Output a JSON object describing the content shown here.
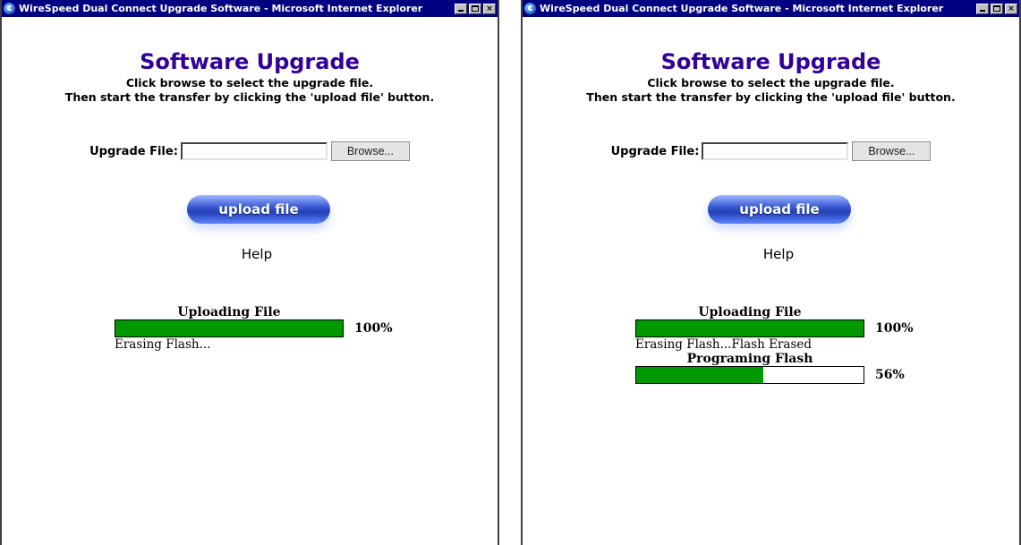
{
  "left_window": {
    "title": "WireSpeed Dual Connect Upgrade Software - Microsoft Internet Explorer",
    "heading": "Software Upgrade",
    "instruction_line1": "Click browse to select the upgrade file.",
    "instruction_line2": "Then start the transfer by clicking the 'upload file' button.",
    "file_label": "Upgrade File:",
    "file_value": "",
    "browse_label": "Browse...",
    "upload_label": "upload file",
    "help_label": "Help",
    "upload_progress": {
      "title": "Uploading File",
      "percent_label": "100%",
      "fraction": 1.0
    },
    "status_text": "Erasing Flash..."
  },
  "right_window": {
    "title": "WireSpeed Dual Connect Upgrade Software - Microsoft Internet Explorer",
    "heading": "Software Upgrade",
    "instruction_line1": "Click browse to select the upgrade file.",
    "instruction_line2": "Then start the transfer by clicking the 'upload file' button.",
    "file_label": "Upgrade File:",
    "file_value": "",
    "browse_label": "Browse...",
    "upload_label": "upload file",
    "help_label": "Help",
    "upload_progress": {
      "title": "Uploading File",
      "percent_label": "100%",
      "fraction": 1.0
    },
    "status_text": "Erasing Flash...Flash Erased",
    "program_progress": {
      "title": "Programing Flash",
      "percent_label": "56%",
      "fraction": 0.56
    }
  },
  "colors": {
    "titlebar": "#000080",
    "heading": "#330099",
    "progress_fill": "#009900"
  },
  "icons": {
    "titlebar_icon": "internet-explorer-icon"
  }
}
